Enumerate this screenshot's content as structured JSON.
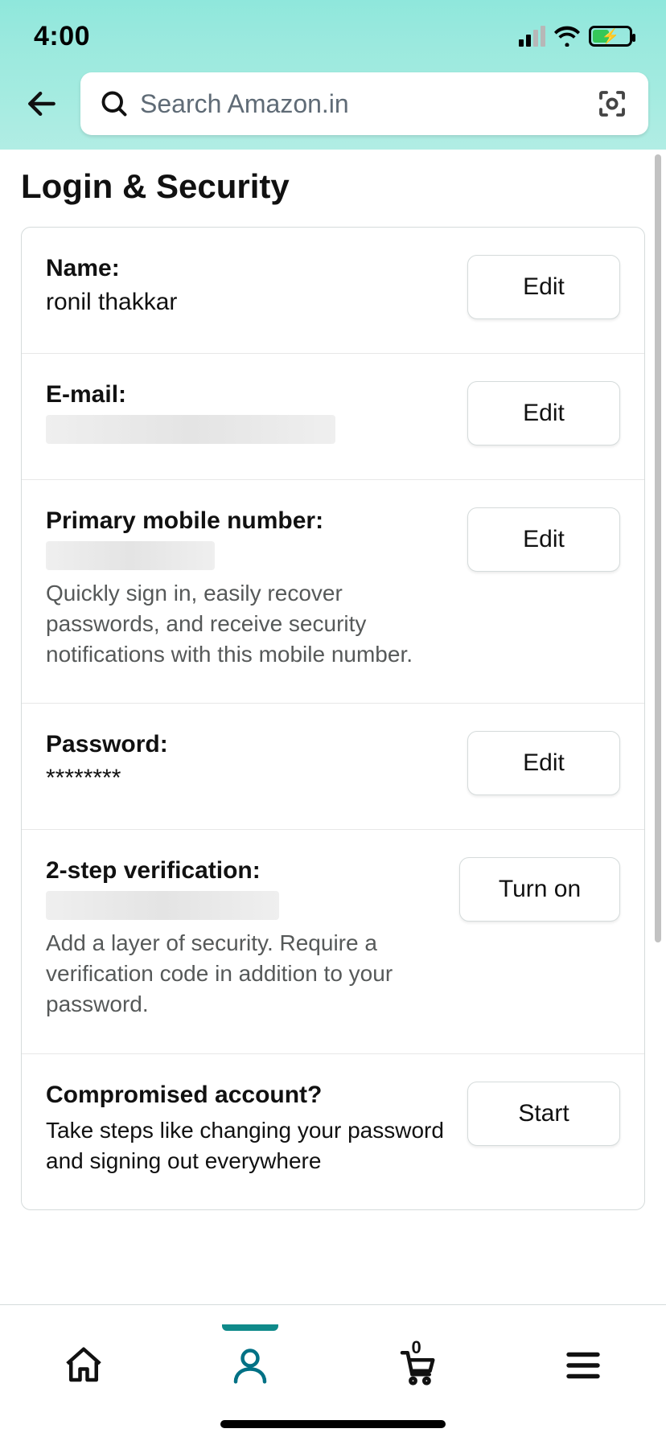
{
  "status": {
    "time": "4:00"
  },
  "search": {
    "placeholder": "Search Amazon.in"
  },
  "page": {
    "title": "Login & Security"
  },
  "rows": {
    "name": {
      "label": "Name:",
      "value": "ronil thakkar",
      "button": "Edit"
    },
    "email": {
      "label": "E-mail:",
      "button": "Edit"
    },
    "mobile": {
      "label": "Primary mobile number:",
      "desc": "Quickly sign in, easily recover passwords, and receive security notifications with this mobile number.",
      "button": "Edit"
    },
    "password": {
      "label": "Password:",
      "value": "********",
      "button": "Edit"
    },
    "twostep": {
      "label": "2-step verification:",
      "desc": "Add a layer of security. Require a verification code in addition to your password.",
      "button": "Turn on"
    },
    "compromised": {
      "label": "Compromised account?",
      "desc": "Take steps like changing your password and signing out everywhere",
      "button": "Start"
    }
  },
  "nav": {
    "cart_count": "0"
  }
}
